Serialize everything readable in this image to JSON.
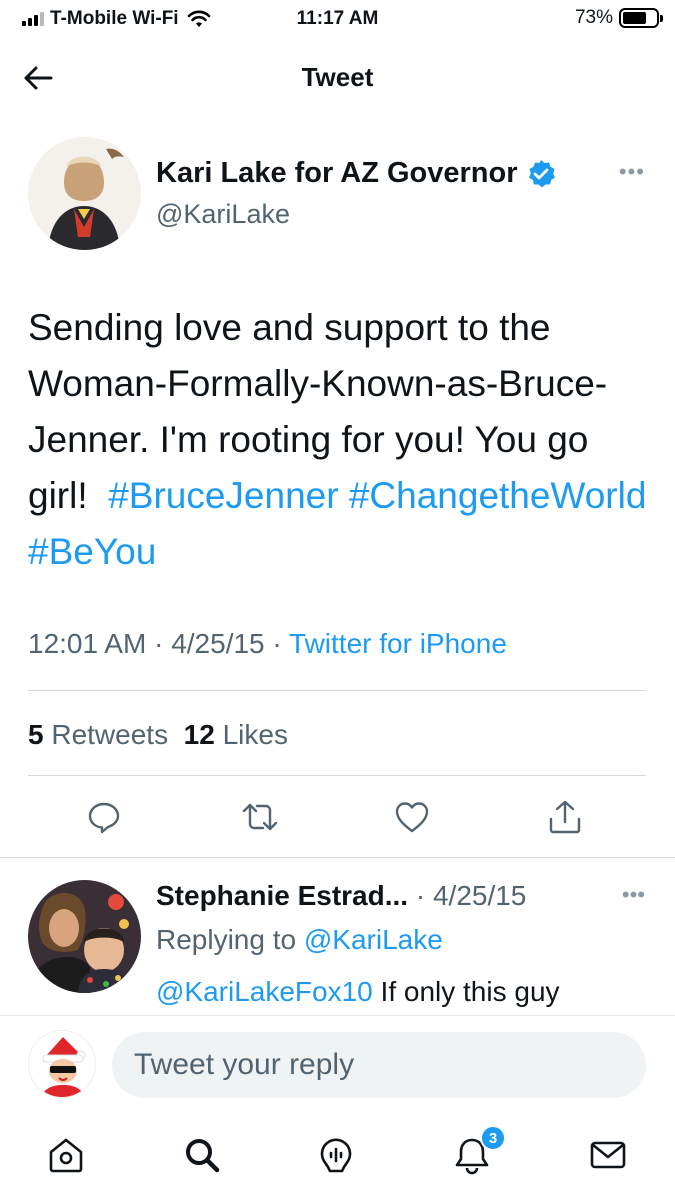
{
  "status_bar": {
    "carrier": "T-Mobile Wi-Fi",
    "time": "11:17 AM",
    "battery_percent": "73%",
    "battery_level": 0.73,
    "signal_bars_active": 3,
    "signal_bars_total": 4
  },
  "nav": {
    "title": "Tweet",
    "back_icon": "arrow-left-icon"
  },
  "tweet": {
    "author_name": "Kari Lake for AZ Governor",
    "handle": "@KariLake",
    "verified": true,
    "text_plain": "Sending love and support to the Woman-Formally-Known-as-Bruce-Jenner. I'm rooting for you! You go girl!",
    "hashtags": [
      "#BruceJenner",
      "#ChangetheWorld",
      "#BeYou"
    ],
    "time": "12:01 AM",
    "date": "4/25/15",
    "source": "Twitter for iPhone",
    "separator": "·",
    "retweets_count": "5",
    "retweets_label": "Retweets",
    "likes_count": "12",
    "likes_label": "Likes"
  },
  "actions": [
    {
      "icon": "reply-icon"
    },
    {
      "icon": "retweet-icon"
    },
    {
      "icon": "like-icon"
    },
    {
      "icon": "share-icon"
    }
  ],
  "reply": {
    "name": "Stephanie Estrad...",
    "date": "· 4/25/15",
    "replying_prefix": "Replying to",
    "replying_to": "@KariLake",
    "mention": "@KariLakeFox10",
    "text": "If only this guy"
  },
  "composer": {
    "placeholder": "Tweet your reply"
  },
  "tabbar": {
    "items": [
      {
        "icon": "home-icon"
      },
      {
        "icon": "search-icon"
      },
      {
        "icon": "spaces-icon"
      },
      {
        "icon": "notifications-icon",
        "badge": "3"
      },
      {
        "icon": "messages-icon"
      }
    ]
  },
  "colors": {
    "accent": "#1d9bf0",
    "text": "#0f1419",
    "secondary": "#536471",
    "divider": "#cfd9de"
  }
}
